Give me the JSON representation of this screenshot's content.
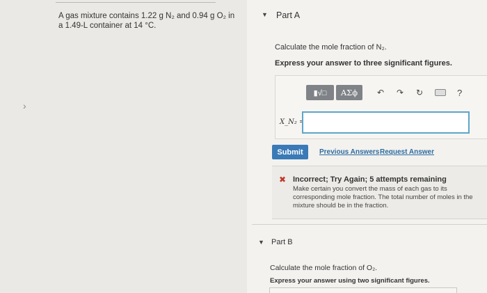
{
  "problem": {
    "text": "A gas mixture contains 1.22 g N₂ and 0.94 g O₂ in a 1.49-L container at 14 °C."
  },
  "partA": {
    "title": "Part A",
    "prompt": "Calculate the mole fraction of N₂.",
    "instruction": "Express your answer to three significant figures.",
    "toolbar": {
      "sqrt_label": "▮√□",
      "greek_label": "AΣϕ",
      "help_label": "?"
    },
    "answer_label": "X_N₂ =",
    "answer_value": "",
    "submit_label": "Submit",
    "previous_answers_label": "Previous Answers",
    "request_answer_label": "Request Answer",
    "feedback": {
      "icon": "✖",
      "title": "Incorrect; Try Again; 5 attempts remaining",
      "body": "Make certain you convert the mass of each gas to its corresponding mole fraction. The total number of moles in the mixture should be in the fraction."
    }
  },
  "partB": {
    "title": "Part B",
    "prompt": "Calculate the mole fraction of O₂.",
    "instruction": "Express your answer using two significant figures."
  },
  "colors": {
    "accent": "#3a7ab7",
    "input_border": "#5da5c8",
    "error": "#c0392b"
  }
}
